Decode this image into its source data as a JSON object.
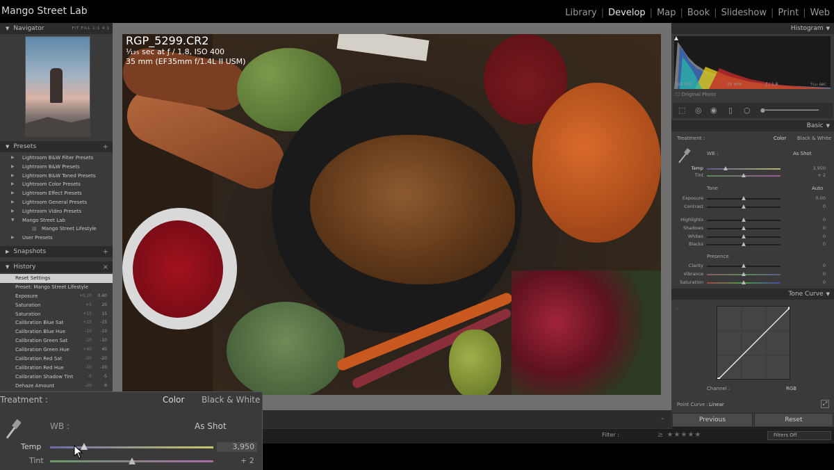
{
  "app": {
    "title": "Mango Street Lab"
  },
  "modules": [
    {
      "label": "Library",
      "active": false
    },
    {
      "label": "Develop",
      "active": true
    },
    {
      "label": "Map",
      "active": false
    },
    {
      "label": "Book",
      "active": false
    },
    {
      "label": "Slideshow",
      "active": false
    },
    {
      "label": "Print",
      "active": false
    },
    {
      "label": "Web",
      "active": false
    }
  ],
  "left": {
    "navigator": {
      "title": "Navigator",
      "options": "FIT  FILL  1:1  4:1"
    },
    "presets": {
      "title": "Presets",
      "items": [
        {
          "label": "Lightroom B&W Filter Presets"
        },
        {
          "label": "Lightroom B&W Presets"
        },
        {
          "label": "Lightroom B&W Toned Presets"
        },
        {
          "label": "Lightroom Color Presets"
        },
        {
          "label": "Lightroom Effect Presets"
        },
        {
          "label": "Lightroom General Presets"
        },
        {
          "label": "Lightroom Video Presets"
        },
        {
          "label": "Mango Street Lab",
          "expanded": true
        },
        {
          "label": "Mango Street Lifestyle",
          "sub": true
        },
        {
          "label": "User Presets"
        }
      ]
    },
    "snapshots": {
      "title": "Snapshots"
    },
    "history": {
      "title": "History",
      "items": [
        {
          "label": "Reset Settings",
          "from": "",
          "to": "",
          "selected": true
        },
        {
          "label": "Preset: Mango Street Lifestyle",
          "from": "",
          "to": ""
        },
        {
          "label": "Exposure",
          "from": "+0.20",
          "to": "0.40"
        },
        {
          "label": "Saturation",
          "from": "+5",
          "to": "20"
        },
        {
          "label": "Saturation",
          "from": "+15",
          "to": "15"
        },
        {
          "label": "Calibration Blue Sat",
          "from": "+15",
          "to": "-15"
        },
        {
          "label": "Calibration Blue Hue",
          "from": "-10",
          "to": "-10"
        },
        {
          "label": "Calibration Green Sat",
          "from": "-10",
          "to": "-10"
        },
        {
          "label": "Calibration Green Hue",
          "from": "+40",
          "to": "40"
        },
        {
          "label": "Calibration Red Sat",
          "from": "-20",
          "to": "-20"
        },
        {
          "label": "Calibration Red Hue",
          "from": "-10",
          "to": "-10"
        },
        {
          "label": "Calibration Shadow Tint",
          "from": "-5",
          "to": "-5"
        },
        {
          "label": "Dehaze Amount",
          "from": "-20",
          "to": "8"
        }
      ]
    }
  },
  "photo": {
    "filename": "RGP_5299.CR2",
    "exposure": "¹⁄₁₂₅ sec at ƒ / 1.8, ISO 400",
    "lens": "35 mm (EF35mm f/1.4L II USM)"
  },
  "right": {
    "histogram": {
      "title": "Histogram",
      "iso": "ISO 400",
      "focal": "35 mm",
      "aperture": "ƒ / 1.8",
      "shutter": "¹⁄₁₂₅ sec",
      "original_photo": "Original Photo"
    },
    "basic": {
      "title": "Basic",
      "treatment_label": "Treatment :",
      "color": "Color",
      "bw": "Black & White",
      "wb_label": "WB :",
      "wb_value": "As Shot",
      "tone_label": "Tone",
      "auto": "Auto",
      "presence_label": "Presence",
      "sliders": [
        {
          "label": "Temp",
          "value": "3,950",
          "pos": 0.25
        },
        {
          "label": "Tint",
          "value": "+ 2",
          "pos": 0.5
        },
        {
          "label": "Exposure",
          "value": "0.00",
          "pos": 0.5
        },
        {
          "label": "Contrast",
          "value": "0",
          "pos": 0.5
        },
        {
          "label": "Highlights",
          "value": "0",
          "pos": 0.5
        },
        {
          "label": "Shadows",
          "value": "0",
          "pos": 0.5
        },
        {
          "label": "Whites",
          "value": "0",
          "pos": 0.5
        },
        {
          "label": "Blacks",
          "value": "0",
          "pos": 0.5
        },
        {
          "label": "Clarity",
          "value": "0",
          "pos": 0.5
        },
        {
          "label": "Vibrance",
          "value": "0",
          "pos": 0.5
        },
        {
          "label": "Saturation",
          "value": "0",
          "pos": 0.5
        }
      ]
    },
    "tone_curve": {
      "title": "Tone Curve",
      "channel_label": "Channel :",
      "channel_value": "RGB",
      "point_curve_label": "Point Curve :",
      "point_curve_value": "Linear"
    },
    "buttons": {
      "previous": "Previous",
      "reset": "Reset"
    }
  },
  "filmstrip": {
    "filter_label": "Filter :",
    "stars": "≥ ★★★★★",
    "filters_off": "Filters Off"
  },
  "zoom": {
    "treatment": "Treatment :",
    "color": "Color",
    "bw": "Black & White",
    "wb_label": "WB :",
    "wb_value": "As Shot",
    "temp_label": "Temp",
    "temp_value": "3,950",
    "temp_pos": 0.21,
    "tint_label": "Tint",
    "tint_value": "+ 2",
    "tint_pos": 0.5
  }
}
